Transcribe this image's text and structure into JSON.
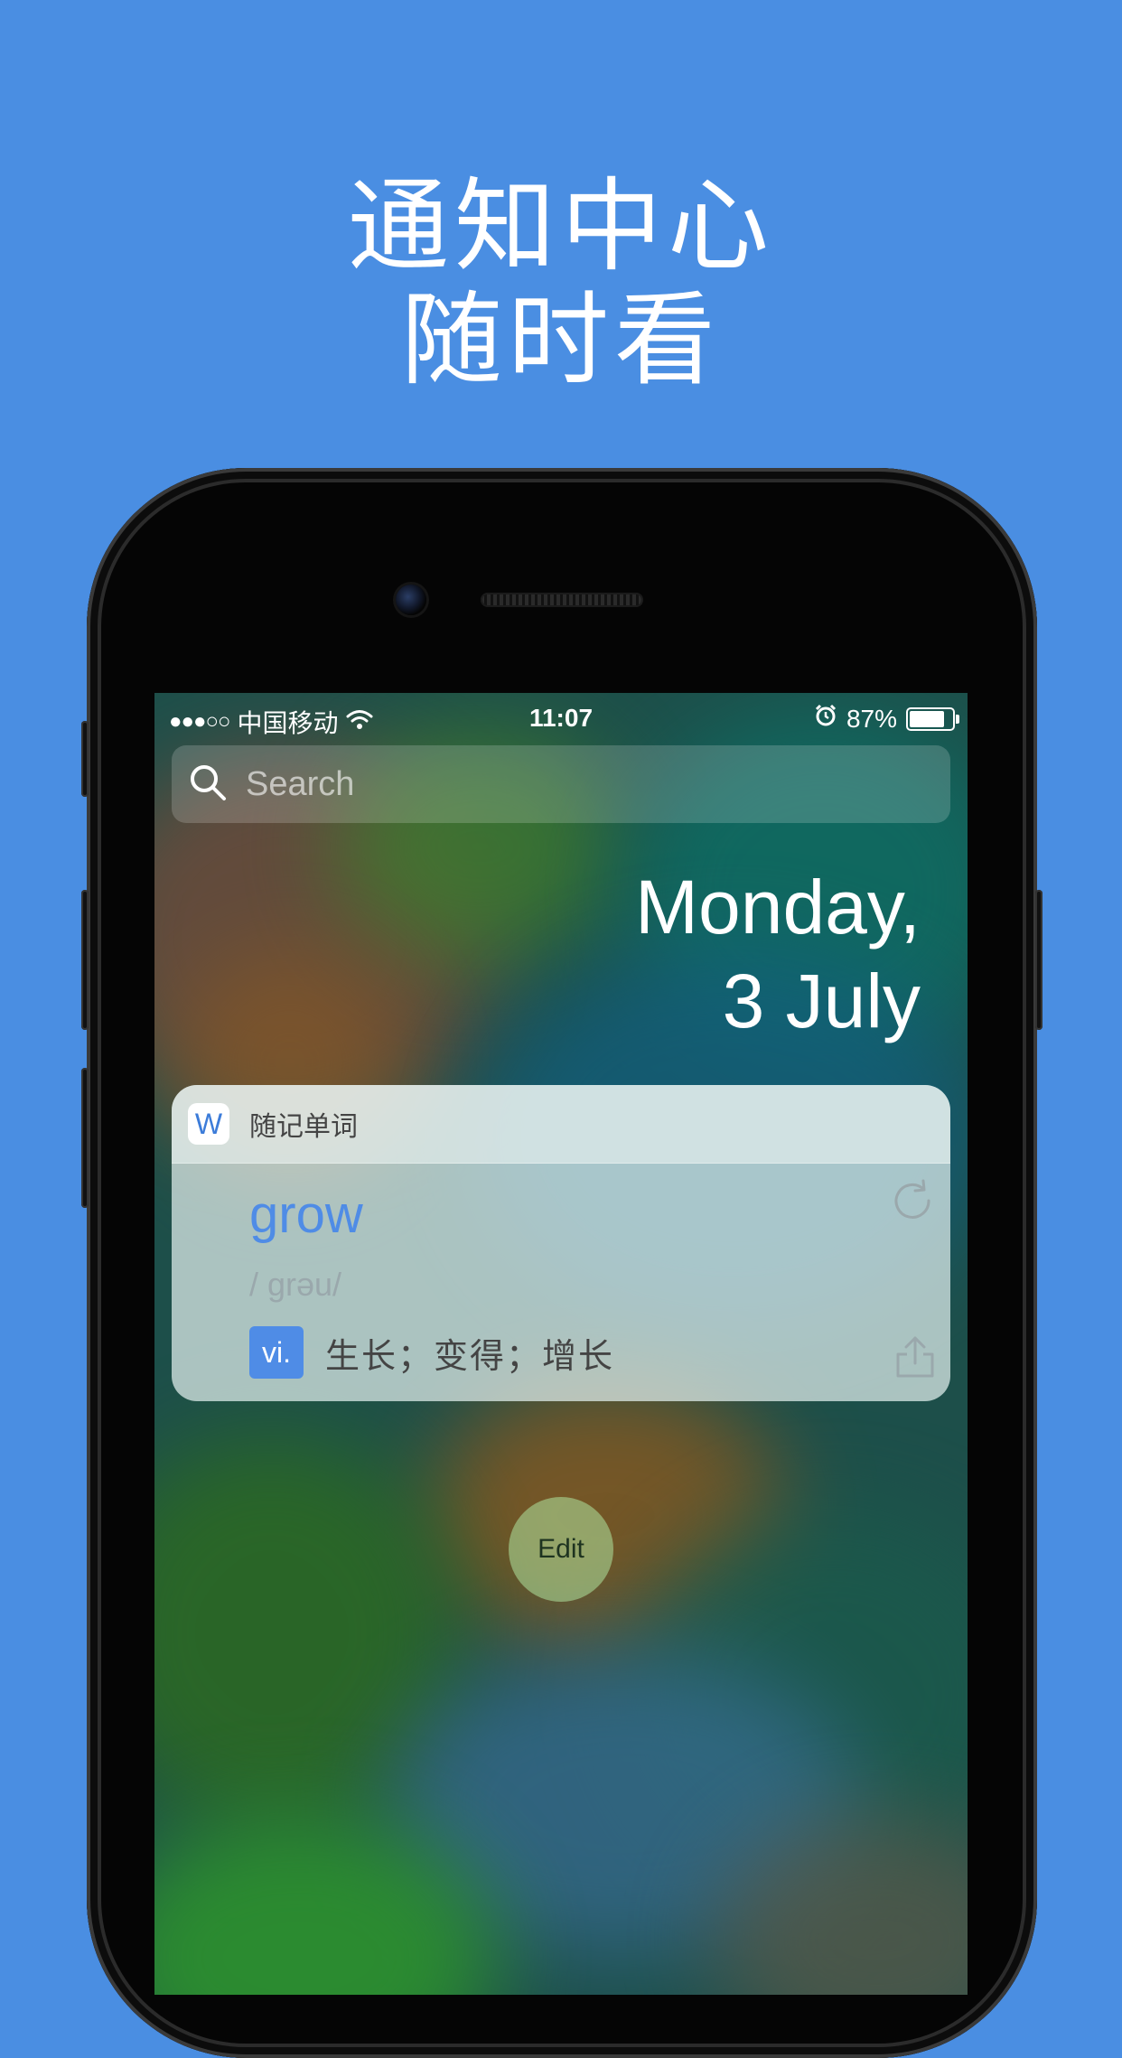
{
  "headline": {
    "line1": "通知中心",
    "line2": "随时看"
  },
  "status_bar": {
    "signal": "●●●○○",
    "carrier": "中国移动",
    "time": "11:07",
    "battery_percent": "87%",
    "battery_level": 0.87
  },
  "search": {
    "placeholder": "Search"
  },
  "date": {
    "line1": "Monday,",
    "line2": "3 July"
  },
  "widget": {
    "app_icon_letter": "W",
    "app_name": "随记单词",
    "word": "grow",
    "phonetic": "/ grəu/",
    "part_of_speech": "vi.",
    "meaning": "生长；变得；增长"
  },
  "edit_button": {
    "label": "Edit"
  },
  "colors": {
    "background": "#4A8EE2",
    "accent": "#4F8CE6"
  }
}
